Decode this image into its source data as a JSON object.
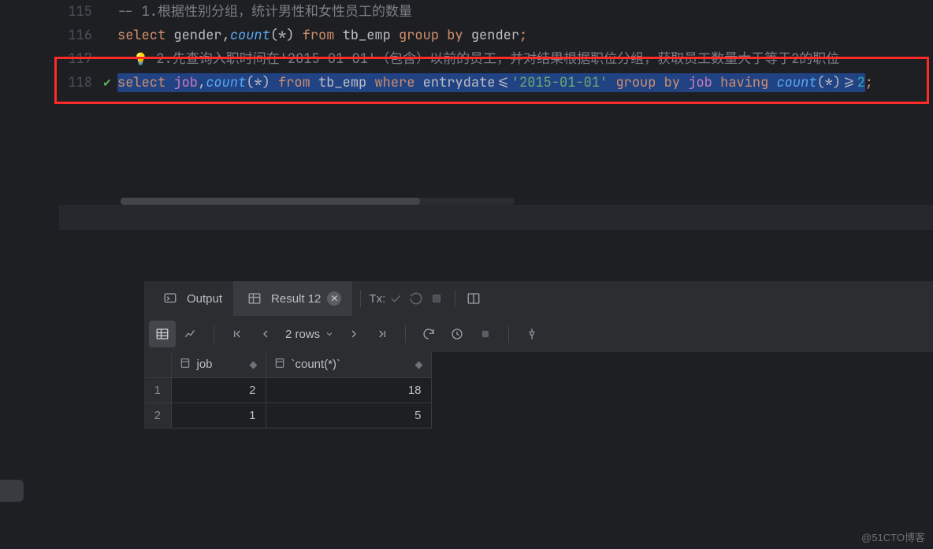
{
  "editor": {
    "lines": [
      {
        "num": "115"
      },
      {
        "num": "116"
      },
      {
        "num": "117"
      },
      {
        "num": "118"
      }
    ],
    "line115_prefix": "-- 1.",
    "line115_text": "根据性别分组，统计男性和女性员工的数量",
    "line116": {
      "select": "select",
      "fields": " gender,",
      "count": "count",
      "lp": "(",
      "star": "*",
      "rp": ")",
      "from": " from",
      "tbl": " tb_emp",
      "group": " group by",
      "col": " gender",
      "semi": ";"
    },
    "line117_dash": "- ",
    "line117_num": " 2.",
    "line117_a": "先查询入职时间在",
    "line117_date": "'2015-01-01'",
    "line117_b": "（包含）以前的员工，并对结果根据职位分组，获取员工数量大于等于2的职位",
    "line118": {
      "select": "select",
      "sp1": " ",
      "job": "job",
      "comma": ",",
      "count": "count",
      "lp": "(",
      "star": "*",
      "rp": ")",
      "from": " from",
      "tbl": " tb_emp",
      "where": " where",
      "col": " entrydate",
      "op": "<=",
      "date": "'2015-01-01'",
      "group": " group by",
      "gcol": " job",
      "having": " having ",
      "count2": "count",
      "lp2": "(",
      "star2": "*",
      "rp2": ")",
      "op2": ">=",
      "two": "2",
      "semi": ";"
    }
  },
  "tabs": {
    "output": "Output",
    "result": "Result 12",
    "tx": "Tx:"
  },
  "toolbar": {
    "rows_label": "2 rows"
  },
  "grid": {
    "headers": {
      "job": "job",
      "count": "`count(*)`"
    },
    "rows": [
      {
        "n": "1",
        "job": "2",
        "count": "18"
      },
      {
        "n": "2",
        "job": "1",
        "count": "5"
      }
    ]
  },
  "watermark": "@51CTO博客"
}
